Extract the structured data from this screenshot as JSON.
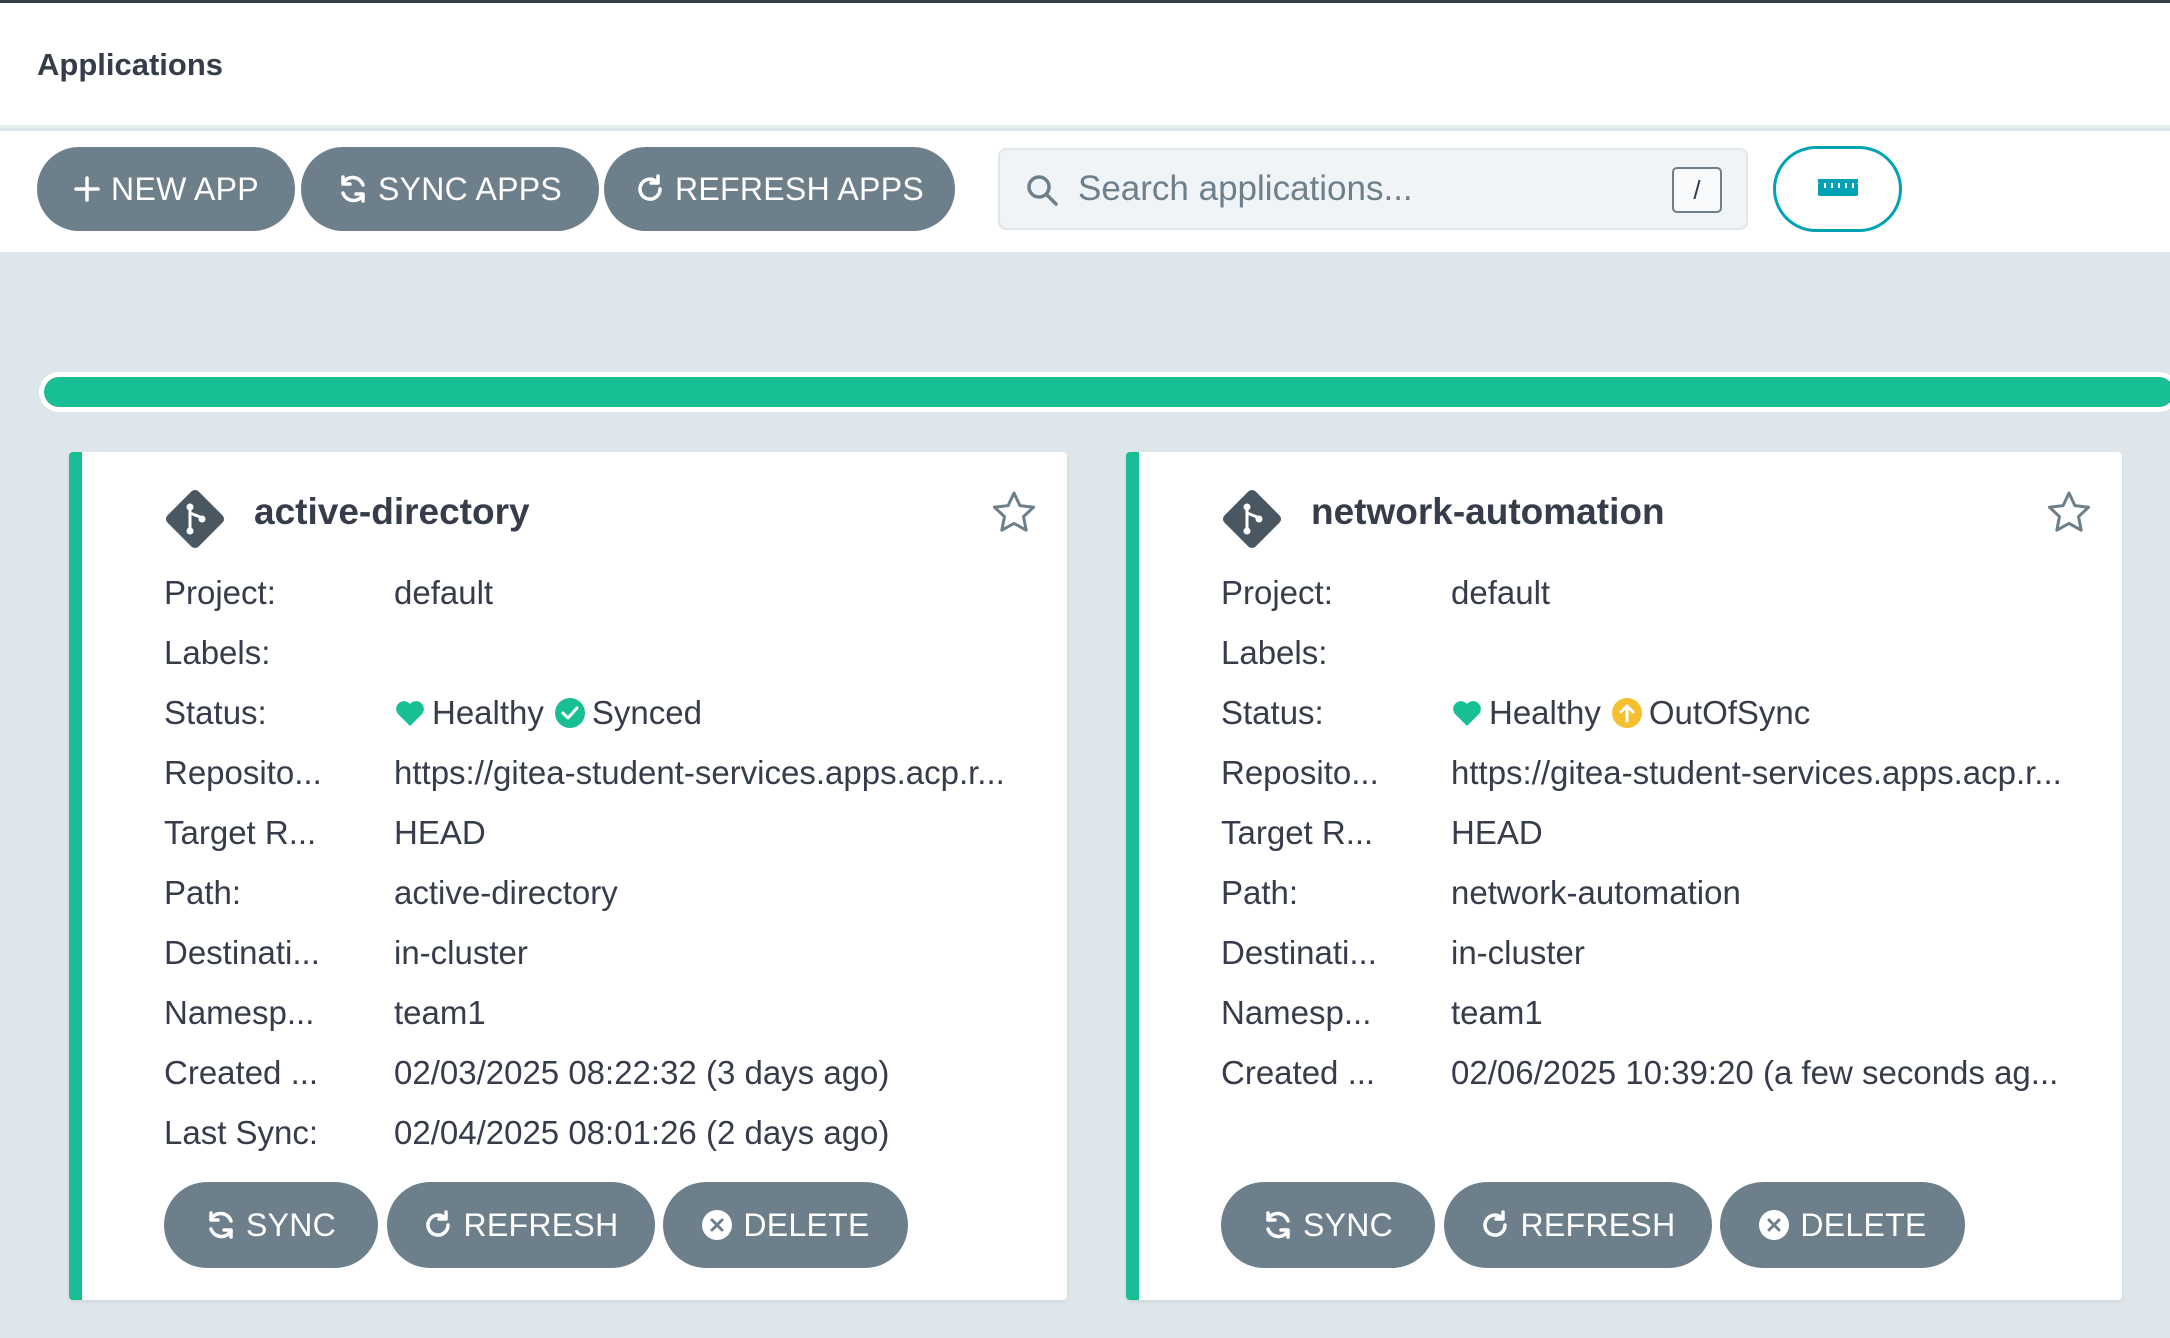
{
  "header": {
    "title": "Applications"
  },
  "toolbar": {
    "new_app": "NEW APP",
    "sync_apps": "SYNC APPS",
    "refresh_apps": "REFRESH APPS",
    "search_placeholder": "Search applications...",
    "search_shortcut": "/"
  },
  "progress": {
    "fraction": 1.0,
    "color": "#18be94"
  },
  "colors": {
    "healthy": "#18be94",
    "synced": "#18be94",
    "out_of_sync": "#f4c030",
    "button": "#6d7f8b",
    "accent": "#00a2b3"
  },
  "apps": [
    {
      "name": "active-directory",
      "rows": [
        {
          "label": "Project:",
          "value": "default"
        },
        {
          "label": "Labels:",
          "value": ""
        },
        {
          "label": "Status:",
          "health": "Healthy",
          "sync": "Synced"
        },
        {
          "label": "Reposito...",
          "value": "https://gitea-student-services.apps.acp.r..."
        },
        {
          "label": "Target R...",
          "value": "HEAD"
        },
        {
          "label": "Path:",
          "value": "active-directory"
        },
        {
          "label": "Destinati...",
          "value": "in-cluster"
        },
        {
          "label": "Namesp...",
          "value": "team1"
        },
        {
          "label": "Created ...",
          "value": "02/03/2025 08:22:32  (3 days ago)"
        },
        {
          "label": "Last Sync:",
          "value": "02/04/2025 08:01:26  (2 days ago)"
        }
      ],
      "buttons": {
        "sync": "SYNC",
        "refresh": "REFRESH",
        "delete": "DELETE"
      }
    },
    {
      "name": "network-automation",
      "rows": [
        {
          "label": "Project:",
          "value": "default"
        },
        {
          "label": "Labels:",
          "value": ""
        },
        {
          "label": "Status:",
          "health": "Healthy",
          "sync": "OutOfSync"
        },
        {
          "label": "Reposito...",
          "value": "https://gitea-student-services.apps.acp.r..."
        },
        {
          "label": "Target R...",
          "value": "HEAD"
        },
        {
          "label": "Path:",
          "value": "network-automation"
        },
        {
          "label": "Destinati...",
          "value": "in-cluster"
        },
        {
          "label": "Namesp...",
          "value": "team1"
        },
        {
          "label": "Created ...",
          "value": "02/06/2025 10:39:20  (a few seconds ag..."
        }
      ],
      "buttons": {
        "sync": "SYNC",
        "refresh": "REFRESH",
        "delete": "DELETE"
      }
    }
  ]
}
